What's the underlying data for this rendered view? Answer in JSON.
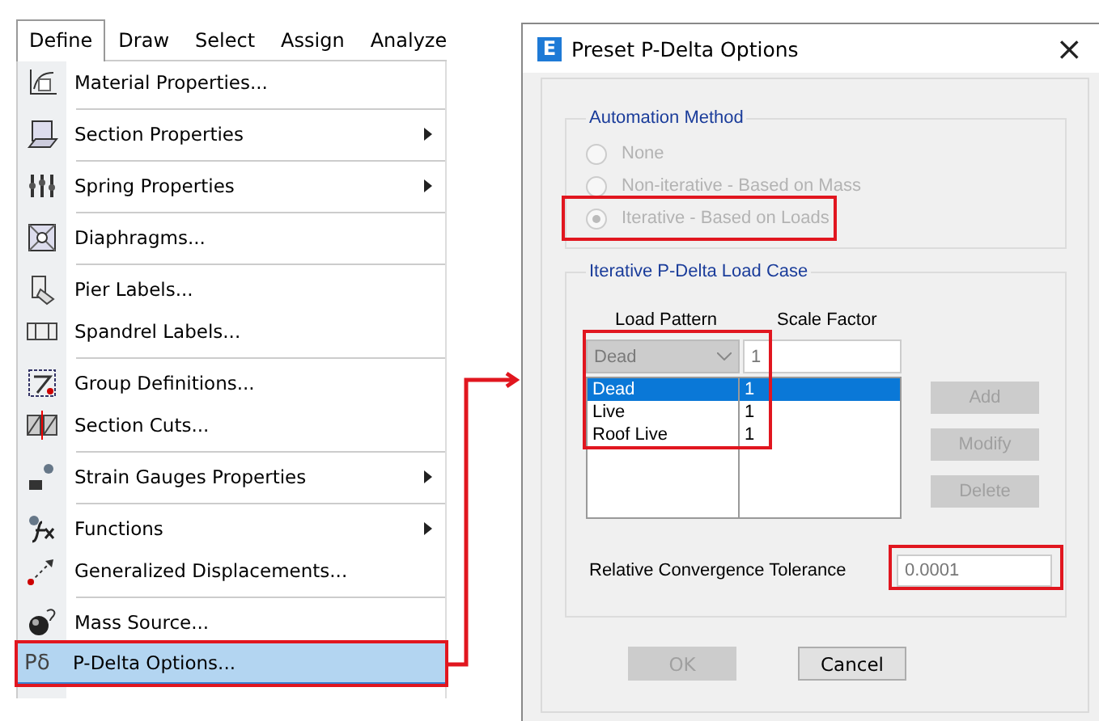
{
  "menubar": {
    "tabs": [
      {
        "label": "Define",
        "selected": true
      },
      {
        "label": "Draw",
        "selected": false
      },
      {
        "label": "Select",
        "selected": false
      },
      {
        "label": "Assign",
        "selected": false
      },
      {
        "label": "Analyze",
        "selected": false
      }
    ]
  },
  "menu": {
    "items": [
      {
        "label": "Material Properties...",
        "submenu": false,
        "separator": true,
        "selected": false
      },
      {
        "label": "Section Properties",
        "submenu": true,
        "separator": true,
        "selected": false
      },
      {
        "label": "Spring Properties",
        "submenu": true,
        "separator": true,
        "selected": false
      },
      {
        "label": "Diaphragms...",
        "submenu": false,
        "separator": true,
        "selected": false
      },
      {
        "label": "Pier Labels...",
        "submenu": false,
        "separator": false,
        "selected": false
      },
      {
        "label": "Spandrel Labels...",
        "submenu": false,
        "separator": true,
        "selected": false
      },
      {
        "label": "Group Definitions...",
        "submenu": false,
        "separator": false,
        "selected": false
      },
      {
        "label": "Section Cuts...",
        "submenu": false,
        "separator": true,
        "selected": false
      },
      {
        "label": "Strain Gauges Properties",
        "submenu": true,
        "separator": true,
        "selected": false
      },
      {
        "label": "Functions",
        "submenu": true,
        "separator": false,
        "selected": false
      },
      {
        "label": "Generalized Displacements...",
        "submenu": false,
        "separator": true,
        "selected": false
      },
      {
        "label": "Mass Source...",
        "submenu": false,
        "separator": false,
        "selected": false
      },
      {
        "label": "P-Delta Options...",
        "submenu": false,
        "separator": false,
        "selected": true,
        "highlighted": true,
        "icon_text": "Pδ"
      }
    ]
  },
  "dialog": {
    "app_icon": "E",
    "title": "Preset P-Delta Options",
    "close": "×",
    "automation": {
      "legend": "Automation Method",
      "options": [
        {
          "label": "None",
          "selected": false,
          "disabled": true,
          "highlighted": false
        },
        {
          "label": "Non-iterative - Based on Mass",
          "selected": false,
          "disabled": true,
          "highlighted": false
        },
        {
          "label": "Iterative - Based on Loads",
          "selected": true,
          "disabled": true,
          "highlighted": true
        }
      ]
    },
    "load_case": {
      "legend": "Iterative P-Delta Load Case",
      "columns": [
        "Load Pattern",
        "Scale Factor"
      ],
      "load_pattern": {
        "value": "Dead",
        "disabled": true,
        "highlighted": true
      },
      "scale_factor": {
        "value": "1"
      },
      "rows": [
        {
          "pattern": "Dead",
          "factor": "1",
          "selected": true
        },
        {
          "pattern": "Live",
          "factor": "1",
          "selected": false
        },
        {
          "pattern": "Roof Live",
          "factor": "1",
          "selected": false
        }
      ],
      "buttons": [
        {
          "label": "Add",
          "disabled": true
        },
        {
          "label": "Modify",
          "disabled": true
        },
        {
          "label": "Delete",
          "disabled": true
        }
      ],
      "tolerance": {
        "label": "Relative Convergence Tolerance",
        "value": "0.0001",
        "highlighted": true
      }
    },
    "buttons": [
      {
        "label": "OK",
        "disabled": true
      },
      {
        "label": "Cancel",
        "disabled": false
      }
    ]
  }
}
